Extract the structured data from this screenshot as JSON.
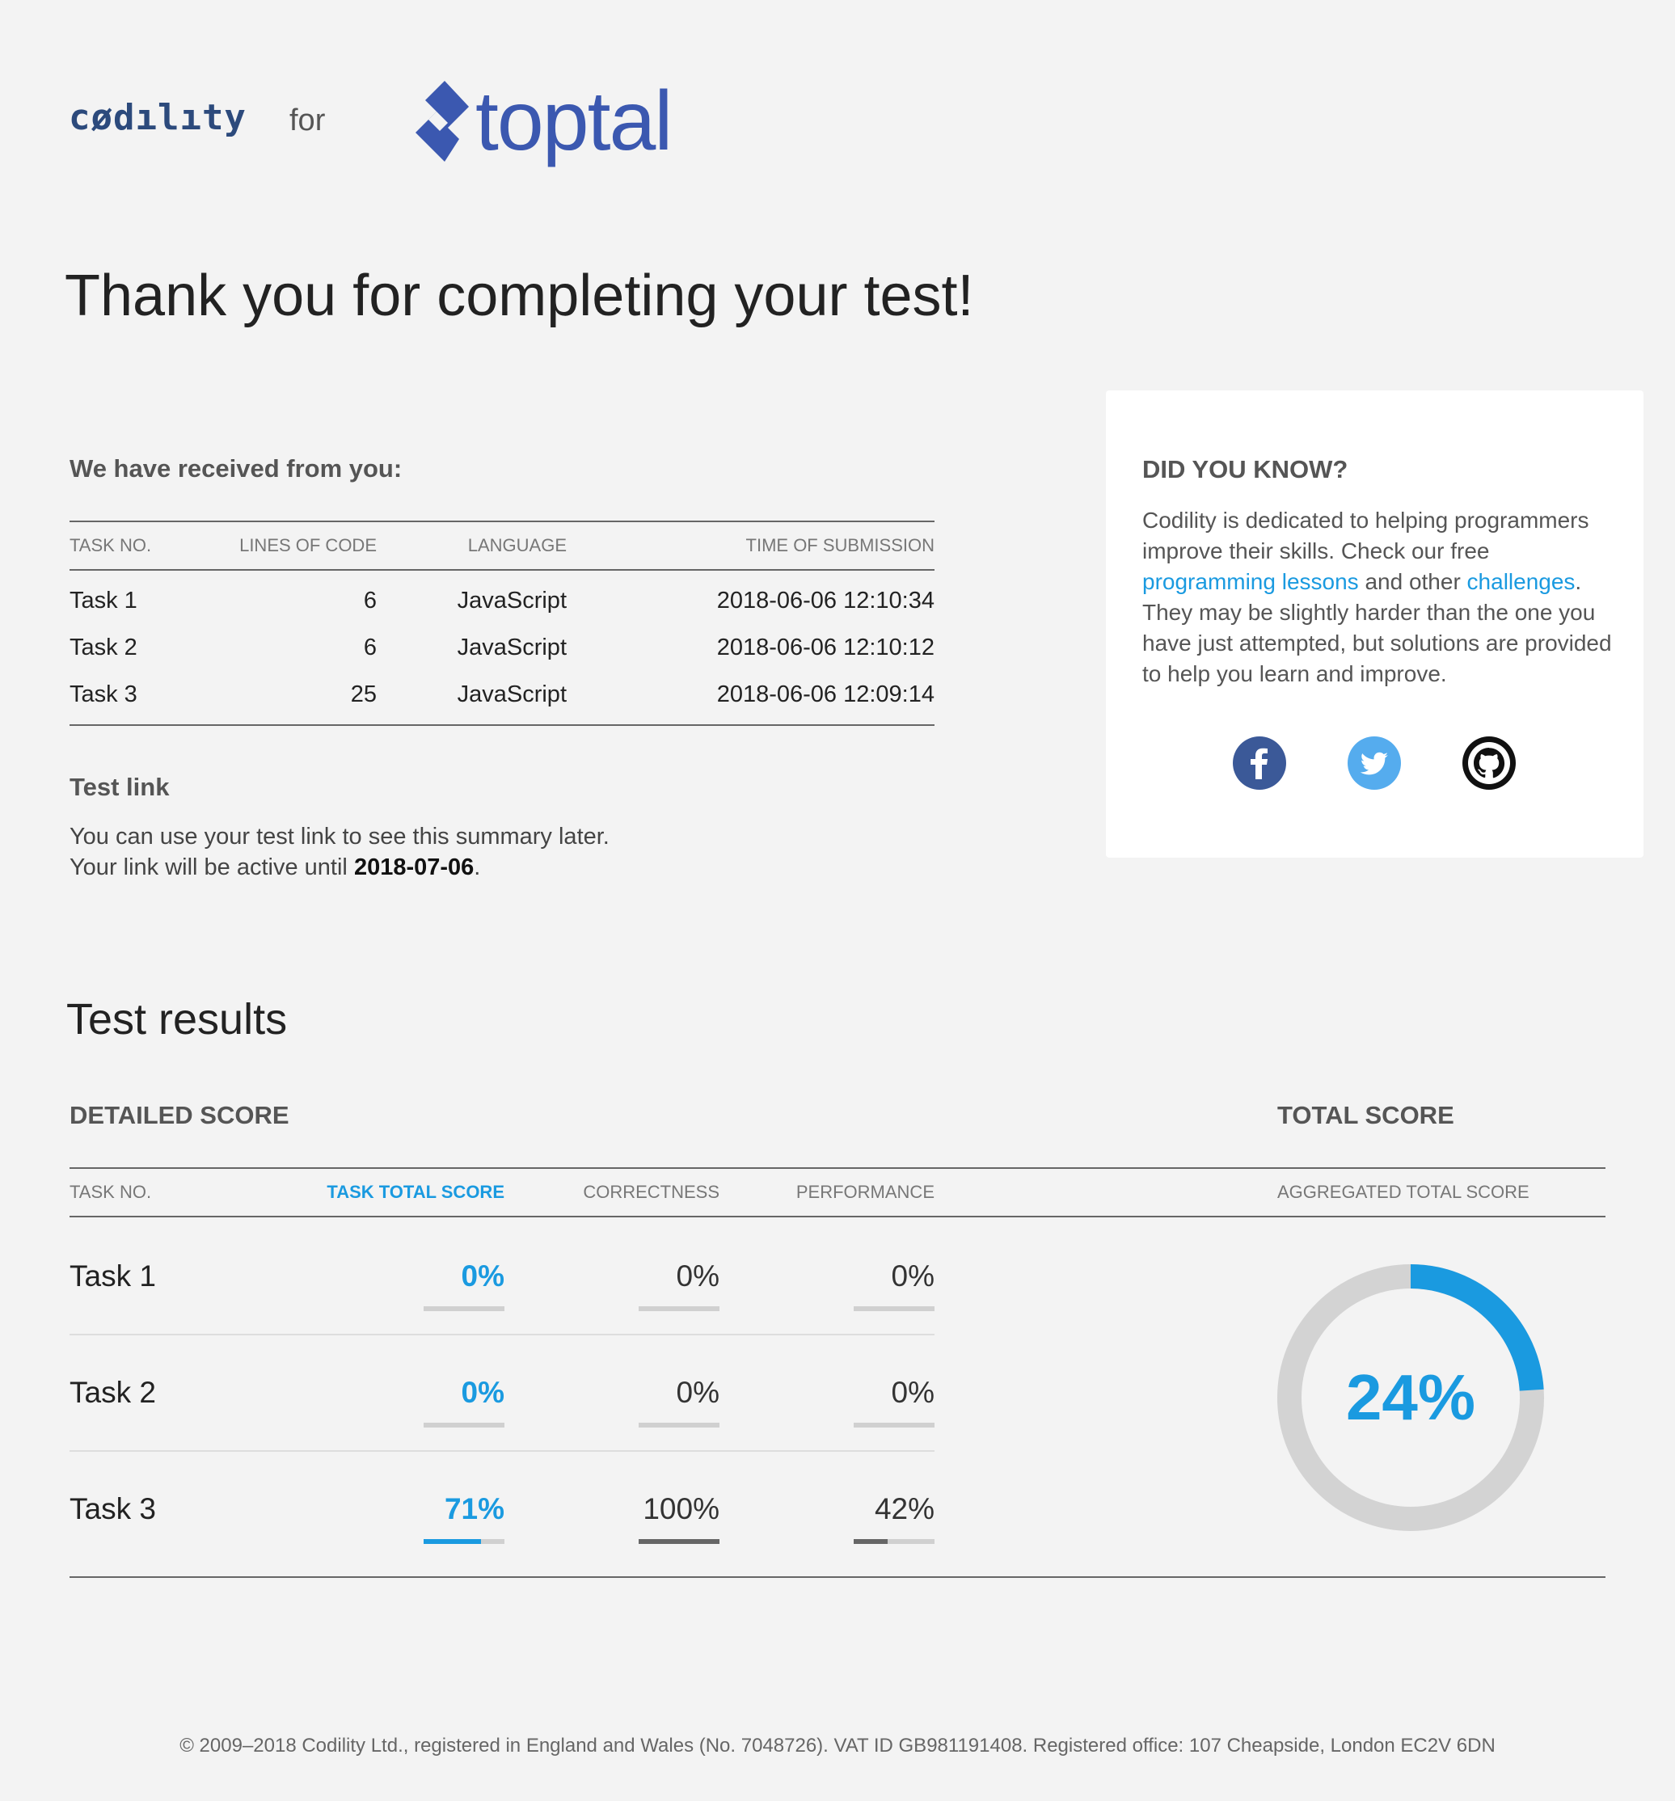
{
  "header": {
    "codility_logo": "cødılıty",
    "for_text": "for",
    "toptal_logo": "toptal"
  },
  "title": "Thank you for completing your test!",
  "received": {
    "heading": "We have received from you:",
    "columns": [
      "TASK NO.",
      "LINES OF CODE",
      "LANGUAGE",
      "TIME OF SUBMISSION"
    ],
    "rows": [
      {
        "task": "Task 1",
        "lines": "6",
        "language": "JavaScript",
        "time": "2018-06-06 12:10:34"
      },
      {
        "task": "Task 2",
        "lines": "6",
        "language": "JavaScript",
        "time": "2018-06-06 12:10:12"
      },
      {
        "task": "Task 3",
        "lines": "25",
        "language": "JavaScript",
        "time": "2018-06-06 12:09:14"
      }
    ]
  },
  "test_link": {
    "heading": "Test link",
    "line1": "You can use your test link to see this summary later.",
    "line2_prefix": "Your link will be active until ",
    "active_until": "2018-07-06",
    "line2_suffix": "."
  },
  "did_you_know": {
    "heading": "DID YOU KNOW?",
    "text_1": "Codility is dedicated to helping programmers improve their skills. Check our free ",
    "link_lessons": "programming lessons",
    "text_2": " and other ",
    "link_challenges": "challenges",
    "text_3": ". They may be slightly harder than the one you have just attempted, but solutions are provided to help you learn and improve.",
    "social_icons": [
      "facebook-icon",
      "twitter-icon",
      "github-icon"
    ]
  },
  "results": {
    "title": "Test results",
    "detailed_heading": "DETAILED SCORE",
    "total_heading": "TOTAL SCORE",
    "columns": {
      "task_no": "TASK NO.",
      "task_total": "TASK TOTAL SCORE",
      "correctness": "CORRECTNESS",
      "performance": "PERFORMANCE",
      "aggregated": "AGGREGATED TOTAL SCORE"
    },
    "rows": [
      {
        "task": "Task 1",
        "total": "0%",
        "correctness": "0%",
        "performance": "0%",
        "total_value": 0,
        "correctness_value": 0,
        "performance_value": 0
      },
      {
        "task": "Task 2",
        "total": "0%",
        "correctness": "0%",
        "performance": "0%",
        "total_value": 0,
        "correctness_value": 0,
        "performance_value": 0
      },
      {
        "task": "Task 3",
        "total": "71%",
        "correctness": "100%",
        "performance": "42%",
        "total_value": 71,
        "correctness_value": 100,
        "performance_value": 42
      }
    ],
    "aggregated_score": "24%",
    "aggregated_value": 24
  },
  "colors": {
    "accent": "#1a9ae0",
    "toptal": "#3b58b0",
    "codility": "#2c4a7c"
  },
  "footer": "© 2009–2018 Codility Ltd., registered in England and Wales (No. 7048726). VAT ID GB981191408. Registered office: 107 Cheapside, London EC2V 6DN"
}
